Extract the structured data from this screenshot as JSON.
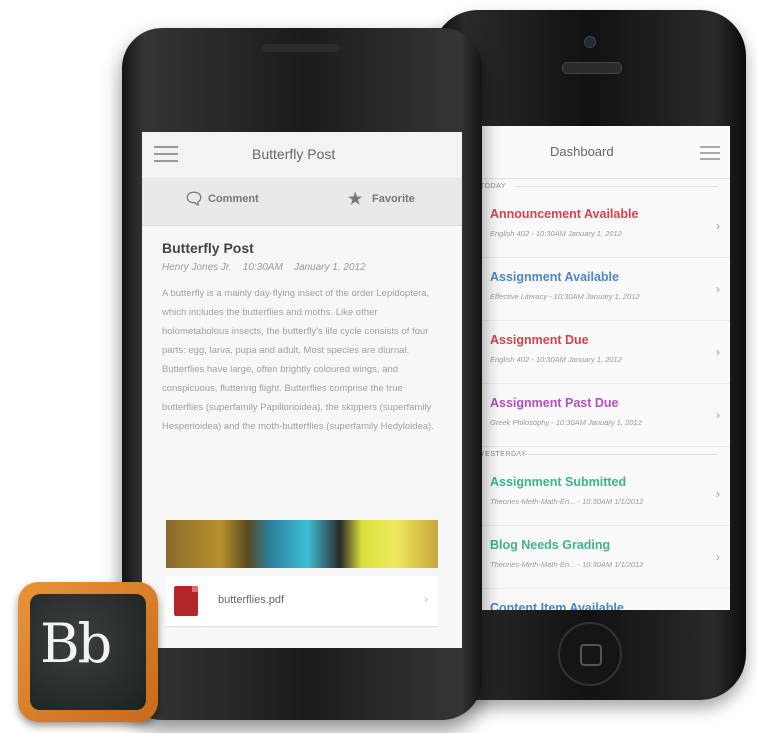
{
  "ios": {
    "header_title": "Dashboard",
    "sections": [
      {
        "label": "TODAY",
        "items": [
          {
            "title": "Announcement Available",
            "meta": "English 402  -  10:30AM  January 1, 2012",
            "color": "#d8424b"
          },
          {
            "title": "Assignment Available",
            "meta": "Effective Literacy  -  10:30AM  January 1, 2012",
            "color": "#4a87c8"
          },
          {
            "title": "Assignment Due",
            "meta": "English 402  -  10:30AM  January 1, 2012",
            "color": "#d8424b"
          },
          {
            "title": "Assignment Past Due",
            "meta": "Greek Philosophy  -  10:30AM  January 1, 2012",
            "color": "#b14fc2"
          }
        ]
      },
      {
        "label": "YESTERDAY",
        "items": [
          {
            "title": "Assignment Submitted",
            "meta": "Theories-Meth-Math-En...  -  10:30AM  1/1/2012",
            "color": "#3db48a"
          },
          {
            "title": "Blog Needs Grading",
            "meta": "Theories-Meth-Math-En...  -  10:30AM  1/1/2012",
            "color": "#3db48a"
          },
          {
            "title": "Content Item Available",
            "meta": "",
            "color": "#4a87c8"
          }
        ]
      }
    ]
  },
  "android": {
    "header_title": "Butterfly Post",
    "actions": {
      "comment": "Comment",
      "favorite": "Favorite"
    },
    "post": {
      "title": "Butterfly Post",
      "author": "Henry Jones Jr.",
      "time": "10:30AM",
      "date": "January 1, 2012",
      "body": "A butterfly is a mainly day-flying insect of the order Lepidoptera, which includes the butterflies and moths. Like other holometabolous insects, the butterfly's life cycle consists of four parts: egg, larva, pupa and adult. Most species are diurnal. Butterflies have large, often brightly coloured wings, and conspicuous, fluttering flight. Butterflies comprise the true butterflies (superfamily Papilionoidea), the skippers (superfamily Hesperioidea) and the moth-butterflies (superfamily Hedyloidea)."
    },
    "attachment": "butterflies.pdf"
  },
  "logo": {
    "text": "Bb"
  },
  "icons": {
    "menu": "hamburger-menu-icon",
    "comment": "speech-bubble-icon",
    "favorite": "star-icon",
    "chevron": "chevron-right-icon",
    "pdf": "pdf-file-icon"
  }
}
